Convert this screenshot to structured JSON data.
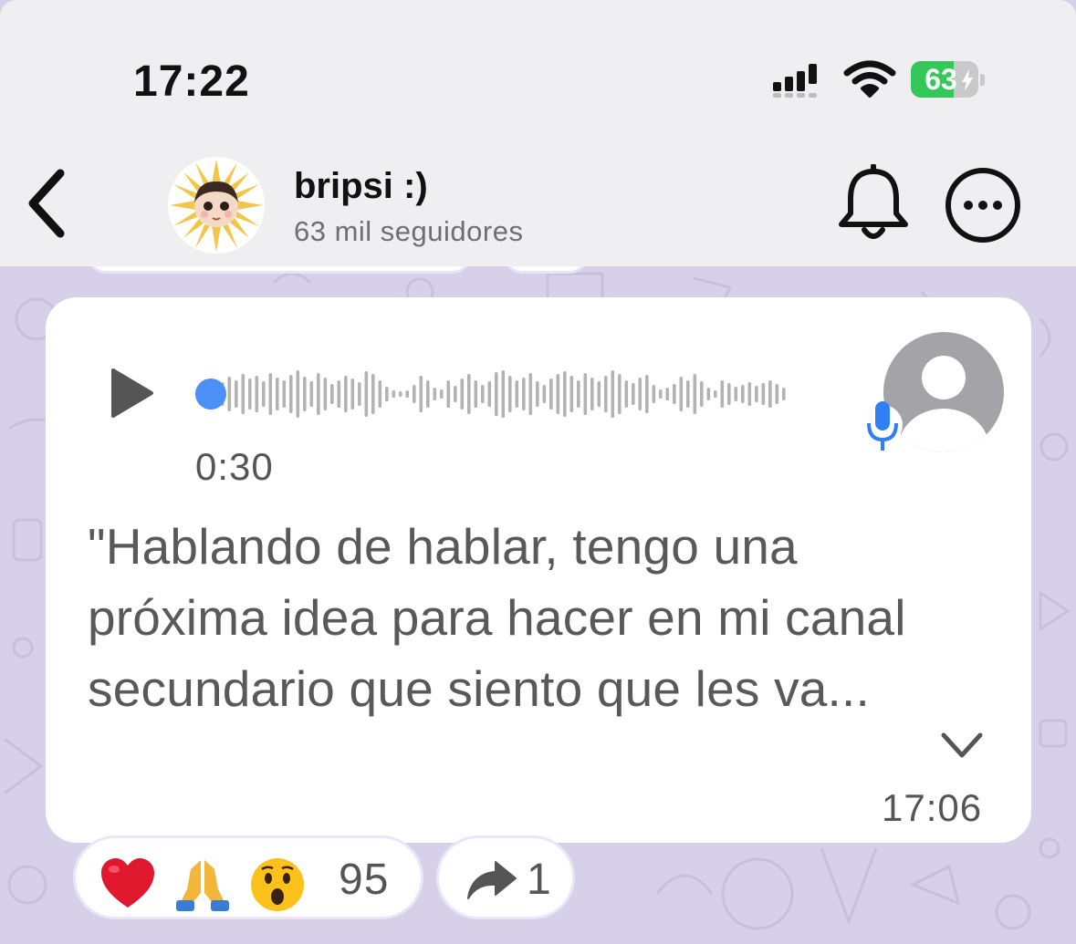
{
  "status_bar": {
    "time": "17:22",
    "battery_level": "63",
    "battery_fraction": 0.63,
    "battery_color": "#34c759",
    "icons": [
      "signal-icon",
      "wifi-icon",
      "battery-charging-icon"
    ]
  },
  "header": {
    "back_icon": "chevron-left-icon",
    "channel_name": "bripsi :)",
    "followers": "63 mil seguidores",
    "bell_icon": "bell-icon",
    "more_icon": "more-horizontal-icon"
  },
  "message": {
    "play_icon": "play-icon",
    "progress_fraction": 0.0,
    "progress_color": "#4a90f5",
    "duration": "0:30",
    "transcript": "\"Hablando de hablar, tengo una próxima idea para hacer en mi canal secundario que siento que les va...",
    "time": "17:06",
    "expand_icon": "chevron-down-icon",
    "sender_icon": "default-avatar-icon",
    "mic_icon": "microphone-icon"
  },
  "reactions": {
    "emojis": [
      "red-heart",
      "folded-hands",
      "surprised-face"
    ],
    "count": "95"
  },
  "forwards": {
    "icon": "forward-arrow-icon",
    "count": "1"
  },
  "colors": {
    "chat_background": "#d6d1e8",
    "header_background": "#efeef0",
    "bubble": "#ffffff"
  }
}
